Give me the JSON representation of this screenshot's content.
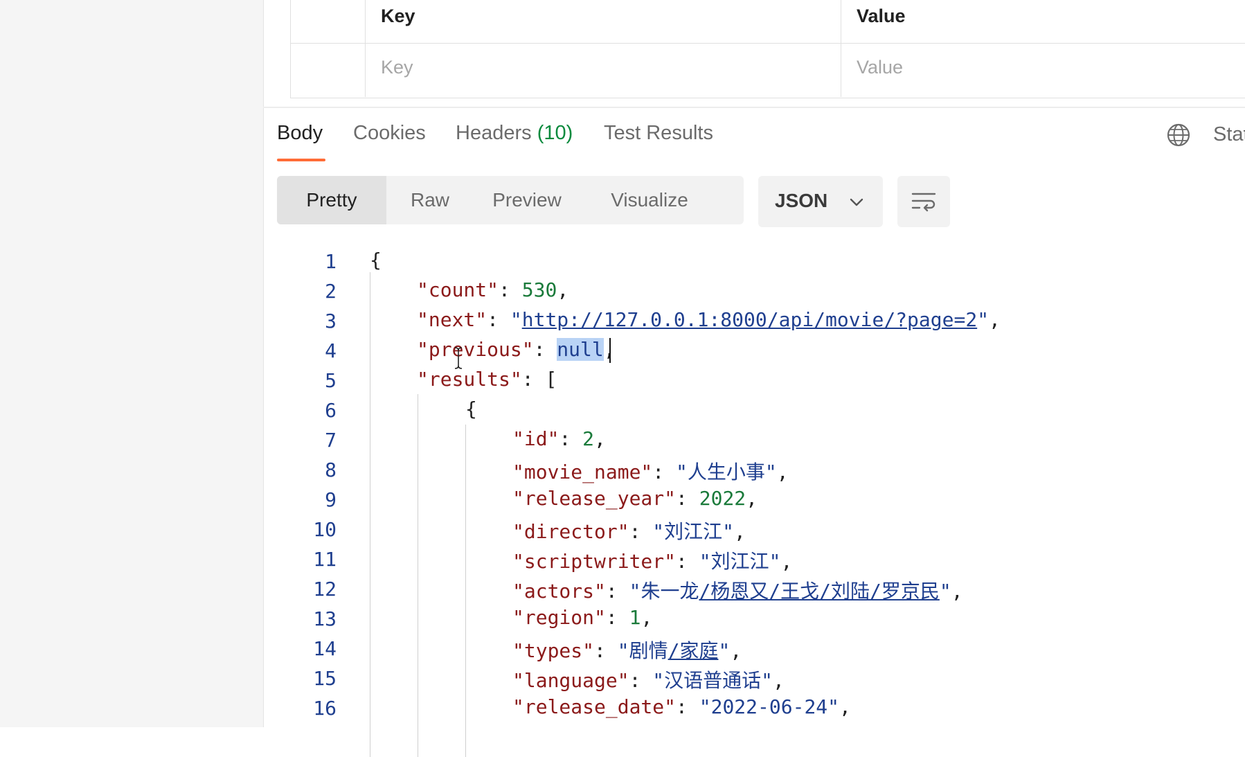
{
  "params_table": {
    "header_key": "Key",
    "header_value": "Value",
    "placeholder_key": "Key",
    "placeholder_value": "Value"
  },
  "response_tabs": {
    "body": "Body",
    "cookies": "Cookies",
    "headers": "Headers",
    "headers_count": "(10)",
    "test_results": "Test Results",
    "status_truncated": "Stat"
  },
  "view_modes": [
    "Pretty",
    "Raw",
    "Preview",
    "Visualize"
  ],
  "format_select": {
    "selected": "JSON"
  },
  "code": {
    "line_numbers": [
      "1",
      "2",
      "3",
      "4",
      "5",
      "6",
      "7",
      "8",
      "9",
      "10",
      "11",
      "12",
      "13",
      "14",
      "15",
      "16"
    ],
    "open_brace": "{",
    "count_key": "\"count\"",
    "count_value": "530",
    "next_key": "\"next\"",
    "next_value": "http://127.0.0.1:8000/api/movie/?page=2",
    "previous_key": "\"previous\"",
    "previous_value": "null",
    "results_key": "\"results\"",
    "results_open": "[",
    "item_open": "{",
    "id_key": "\"id\"",
    "id_value": "2",
    "movie_name_key": "\"movie_name\"",
    "movie_name_value": "人生小事",
    "release_year_key": "\"release_year\"",
    "release_year_value": "2022",
    "director_key": "\"director\"",
    "director_value": "刘江江",
    "scriptwriter_key": "\"scriptwriter\"",
    "scriptwriter_value": "刘江江",
    "actors_key": "\"actors\"",
    "actors_value_first": "朱一龙",
    "actors_value_rest": "/杨恩又/王戈/刘陆/罗京民",
    "region_key": "\"region\"",
    "region_value": "1",
    "types_key": "\"types\"",
    "types_value_first": "剧情",
    "types_value_rest": "/家庭",
    "language_key": "\"language\"",
    "language_value": "汉语普通话",
    "release_date_key": "\"release_date\"",
    "release_date_value": "2022-06-24"
  },
  "colors": {
    "accent": "#ff6c37",
    "count_green": "#0b8a3d",
    "json_key": "#8b1a1a",
    "json_string": "#1f3f8f",
    "json_number": "#1a7a3a",
    "selection": "#b9d3f5"
  },
  "icons": {
    "globe": "globe-icon",
    "chevron": "chevron-down-icon",
    "wrap": "wrap-lines-icon"
  }
}
